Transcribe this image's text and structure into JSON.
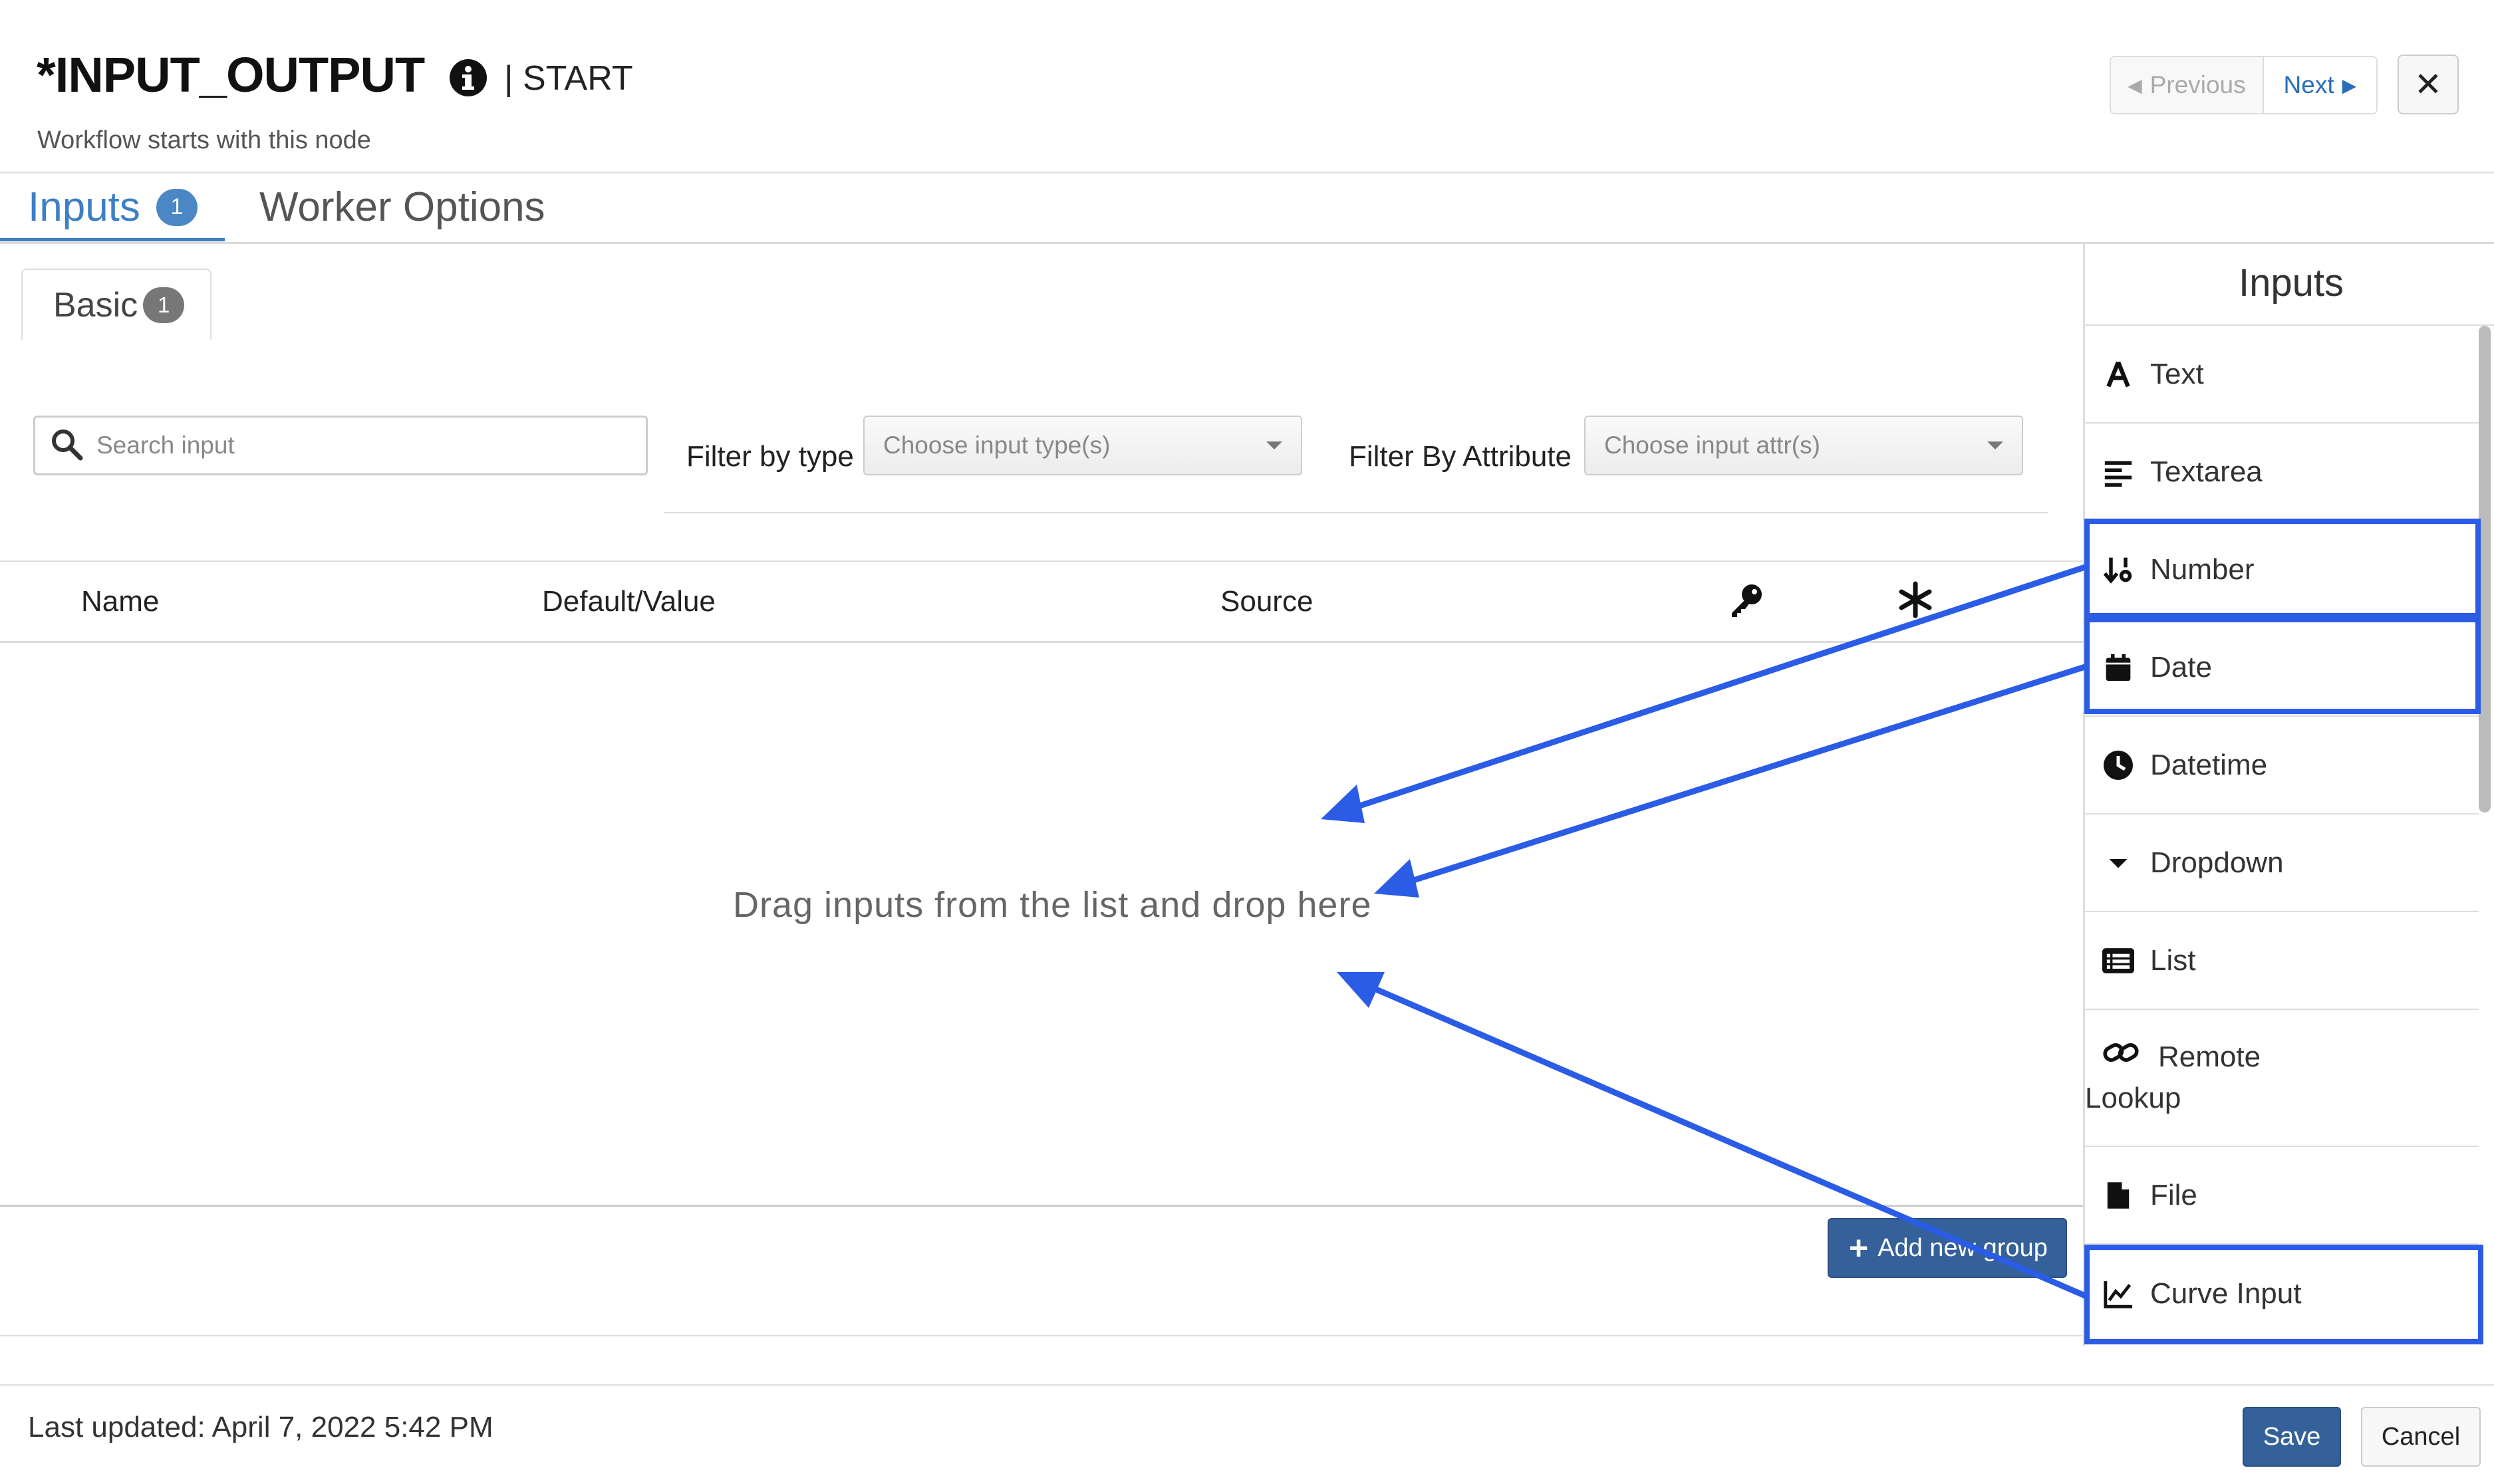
{
  "header": {
    "title": "*INPUT_OUTPUT",
    "node_type": "| START",
    "subtitle": "Workflow starts with this node",
    "previous_label": "Previous",
    "next_label": "Next",
    "close_label": "✕"
  },
  "tabs": {
    "inputs_label": "Inputs",
    "inputs_count": "1",
    "worker_options_label": "Worker Options"
  },
  "subtabs": {
    "basic_label": "Basic",
    "basic_count": "1"
  },
  "filters": {
    "search_placeholder": "Search input",
    "type_label": "Filter by type",
    "type_placeholder": "Choose input type(s)",
    "attr_label": "Filter By Attribute",
    "attr_placeholder": "Choose input attr(s)"
  },
  "table": {
    "columns": [
      "Name",
      "Default/Value",
      "Source"
    ],
    "key_icon": "key-icon",
    "required_icon": "asterisk-icon"
  },
  "drop_zone_text": "Drag inputs from the list and drop here",
  "add_group_label": "Add new group",
  "footer": {
    "last_updated": "Last updated: April 7, 2022 5:42 PM",
    "save_label": "Save",
    "cancel_label": "Cancel"
  },
  "panel": {
    "title": "Inputs",
    "items": [
      {
        "label": "Text",
        "icon": "font-icon"
      },
      {
        "label": "Textarea",
        "icon": "align-left-icon"
      },
      {
        "label": "Number",
        "icon": "sort-numeric-icon"
      },
      {
        "label": "Date",
        "icon": "calendar-icon"
      },
      {
        "label": "Datetime",
        "icon": "clock-icon"
      },
      {
        "label": "Dropdown",
        "icon": "caret-down-icon"
      },
      {
        "label": "List",
        "icon": "list-icon"
      },
      {
        "label": "Remote\nLookup",
        "icon": "link-icon"
      },
      {
        "label": "File",
        "icon": "file-icon"
      },
      {
        "label": "Curve Input",
        "icon": "line-chart-icon"
      }
    ]
  },
  "colors": {
    "accent": "#3d7fc4",
    "primary_button": "#35619a",
    "annotation": "#2b5ce6"
  }
}
